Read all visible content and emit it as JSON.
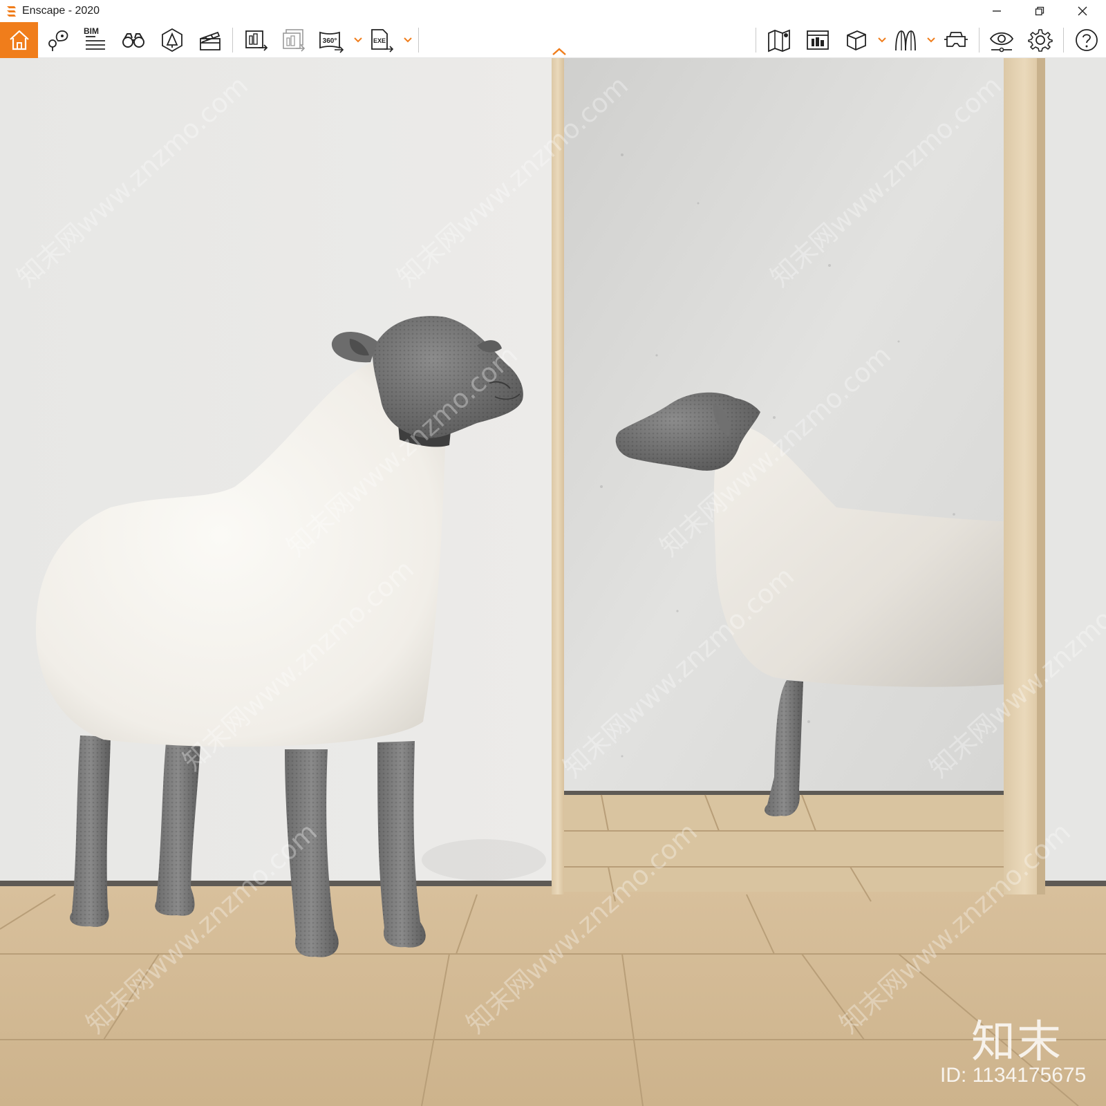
{
  "window": {
    "title": "Enscape - 2020",
    "controls": [
      "minimize",
      "restore",
      "close"
    ]
  },
  "toolbar": {
    "left_icons": [
      "home-icon",
      "location-icon",
      "bim-icon",
      "binoculars-icon",
      "asset-library-icon",
      "video-editor-icon",
      "screenshot-export-icon",
      "batch-render-icon",
      "panorama-360-icon",
      "exe-export-icon"
    ],
    "bim_label": "BIM",
    "panorama_label": "360°",
    "exe_label": "EXE",
    "right_icons": [
      "map-icon",
      "views-icon",
      "section-box-icon",
      "material-editor-icon",
      "vr-headset-icon",
      "visual-settings-icon",
      "general-settings-icon",
      "help-icon"
    ],
    "accent_color": "#f07d1b"
  },
  "watermark": {
    "logo_text": "知末",
    "id_text": "ID: 1134175675",
    "tiled_text": "知末网www.znzmo.com"
  }
}
